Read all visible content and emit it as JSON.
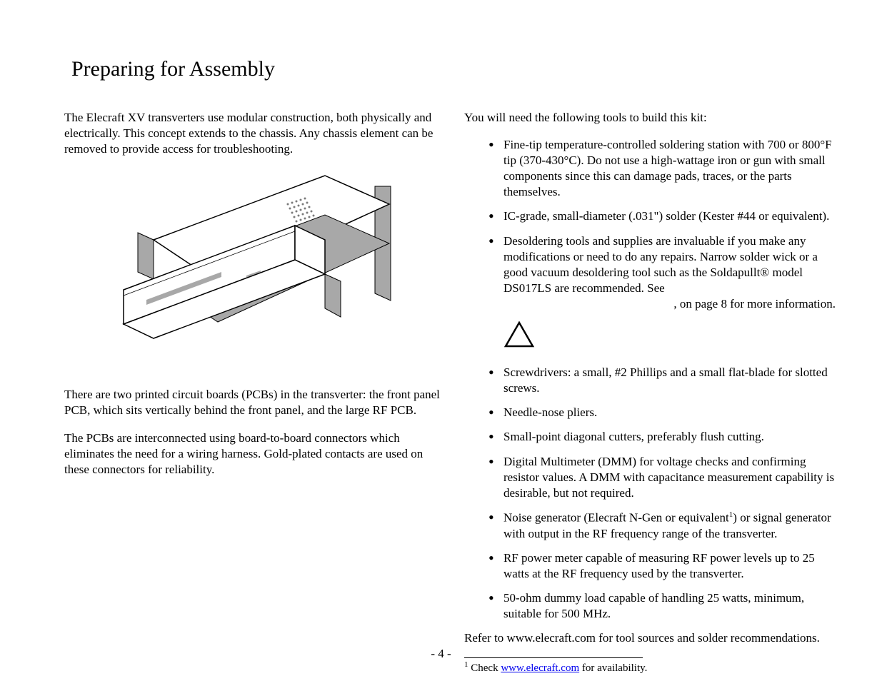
{
  "title": "Preparing for Assembly",
  "left": {
    "p1": "The Elecraft XV transverters use modular construction, both physically and electrically. This concept extends to the chassis. Any chassis element can be removed to provide access for troubleshooting.",
    "p2": "There are two printed circuit boards (PCBs) in the transverter: the front panel PCB, which sits vertically behind the front panel, and the large RF PCB.",
    "p3": "The PCBs are interconnected using board-to-board connectors which eliminates the need for a wiring harness. Gold-plated contacts are used on these connectors for reliability."
  },
  "right": {
    "intro": "You will need the following tools to build this kit:",
    "items1": [
      "Fine-tip temperature-controlled soldering station with 700 or 800°F tip (370-430°C). Do not use a high-wattage iron or gun with small components since this can damage pads, traces, or the parts themselves.",
      "IC-grade, small-diameter (.031\") solder (Kester #44 or equivalent).",
      "Desoldering tools and supplies are invaluable if you make any modifications or need to do any repairs. Narrow solder wick or a good vacuum desoldering tool such as the Soldapullt® model DS017LS are recommended. See"
    ],
    "see_suffix": ", on page 8 for more information.",
    "items2": [
      "Screwdrivers: a small, #2 Phillips and a small flat-blade for slotted screws.",
      "Needle-nose pliers.",
      "Small-point diagonal cutters, preferably flush cutting.",
      "Digital Multimeter (DMM) for voltage checks and confirming resistor values. A DMM with capacitance measurement capability is desirable, but not required."
    ],
    "noise_gen_pre": "Noise generator (Elecraft N-Gen or equivalent",
    "noise_gen_sup": "1",
    "noise_gen_post": ") or signal generator with output in the RF frequency range of the transverter.",
    "items3": [
      "RF power meter capable of measuring RF power levels up to 25 watts at the RF frequency used by the transverter.",
      "50-ohm dummy load capable of handling 25 watts, minimum, suitable for 500 MHz."
    ],
    "refer": "Refer to www.elecraft.com for tool sources and solder recommendations."
  },
  "footnote": {
    "sup": "1",
    "pre": " Check ",
    "link": "www.elecraft.com",
    "post": " for availability."
  },
  "pagenum": "- 4 -"
}
